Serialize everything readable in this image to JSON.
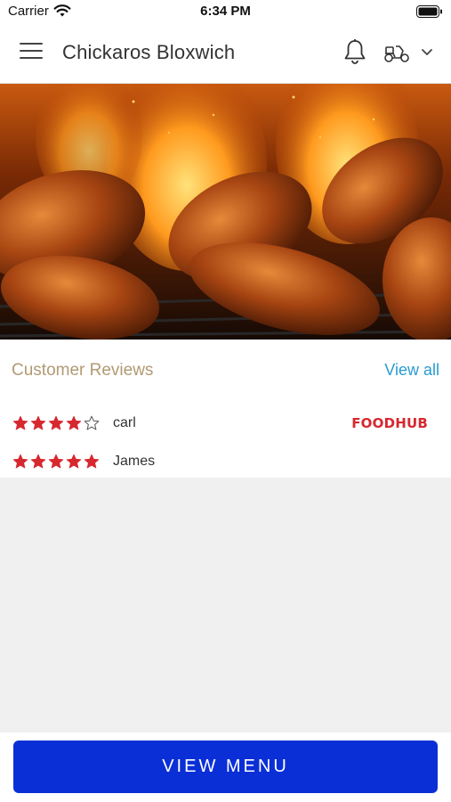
{
  "status_bar": {
    "carrier": "Carrier",
    "time": "6:34 PM"
  },
  "header": {
    "title": "Chickaros Bloxwich",
    "icons": [
      "menu-icon",
      "bell-icon",
      "delivery-scooter-icon",
      "chevron-down-icon"
    ]
  },
  "hero": {
    "icon": "grilled-chicken-wings-image"
  },
  "reviews": {
    "title": "Customer Reviews",
    "view_all_label": "View all",
    "brand_logo_text": "FOODHUB",
    "items": [
      {
        "name": "carl",
        "rating": 4,
        "max_rating": 5
      },
      {
        "name": "James",
        "rating": 5,
        "max_rating": 5
      }
    ]
  },
  "footer": {
    "view_menu_label": "VIEW MENU"
  },
  "colors": {
    "accent_blue": "#0b2fd6",
    "star_red": "#d7282f",
    "link_blue": "#2a9bd0",
    "section_title": "#b29a73",
    "brand_red": "#d7282f"
  }
}
